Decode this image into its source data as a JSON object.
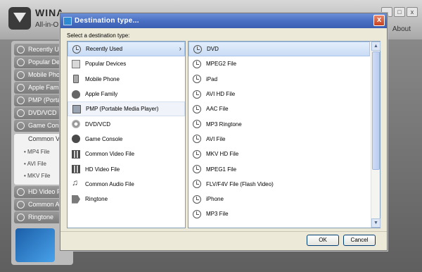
{
  "app": {
    "title": "WINA",
    "subtitle": "All-in-On",
    "about": "About",
    "window_buttons": [
      "_",
      "□",
      "x"
    ],
    "sidebar": [
      {
        "label": "Recently U",
        "icon": "clock-icon"
      },
      {
        "label": "Popular De",
        "icon": "box-icon"
      },
      {
        "label": "Mobile Phon",
        "icon": "phone-icon"
      },
      {
        "label": "Apple Famil",
        "icon": "apple-icon"
      },
      {
        "label": "PMP (Porta",
        "icon": "pmp-icon"
      },
      {
        "label": "DVD/VCD",
        "icon": "disc-icon"
      },
      {
        "label": "Game Cons",
        "icon": "gamepad-icon"
      },
      {
        "label": "HD Video F",
        "icon": "film-icon"
      },
      {
        "label": "Common A",
        "icon": "music-icon"
      },
      {
        "label": "Ringtone",
        "icon": "ringtone-icon"
      }
    ],
    "sidebar_open": {
      "label": "Common V",
      "items": [
        "• MP4 File",
        "• AVI File",
        "• MKV File"
      ]
    }
  },
  "dialog": {
    "title": "Destination type...",
    "close": "x",
    "prompt": "Select a destination type:",
    "categories": [
      {
        "label": "Recently Used",
        "icon": "clock-icon"
      },
      {
        "label": "Popular Devices",
        "icon": "box-icon"
      },
      {
        "label": "Mobile Phone",
        "icon": "phone-icon"
      },
      {
        "label": "Apple Family",
        "icon": "apple-icon"
      },
      {
        "label": "PMP (Portable Media Player)",
        "icon": "pmp-icon"
      },
      {
        "label": "DVD/VCD",
        "icon": "disc-icon"
      },
      {
        "label": "Game Console",
        "icon": "gamepad-icon"
      },
      {
        "label": "Common Video File",
        "icon": "film-icon"
      },
      {
        "label": "HD Video File",
        "icon": "film-icon"
      },
      {
        "label": "Common Audio File",
        "icon": "music-icon"
      },
      {
        "label": "Ringtone",
        "icon": "ringtone-icon"
      }
    ],
    "selected_category": "Recently Used",
    "formats": [
      "DVD",
      "MPEG2 File",
      "iPad",
      "AVI HD File",
      "AAC File",
      "MP3 Ringtone",
      "AVI File",
      "MKV HD File",
      "MPEG1 File",
      "FLV/F4V File (Flash Video)",
      "iPhone",
      "MP3 File"
    ],
    "selected_format": "DVD",
    "ok_label": "OK",
    "cancel_label": "Cancel"
  }
}
